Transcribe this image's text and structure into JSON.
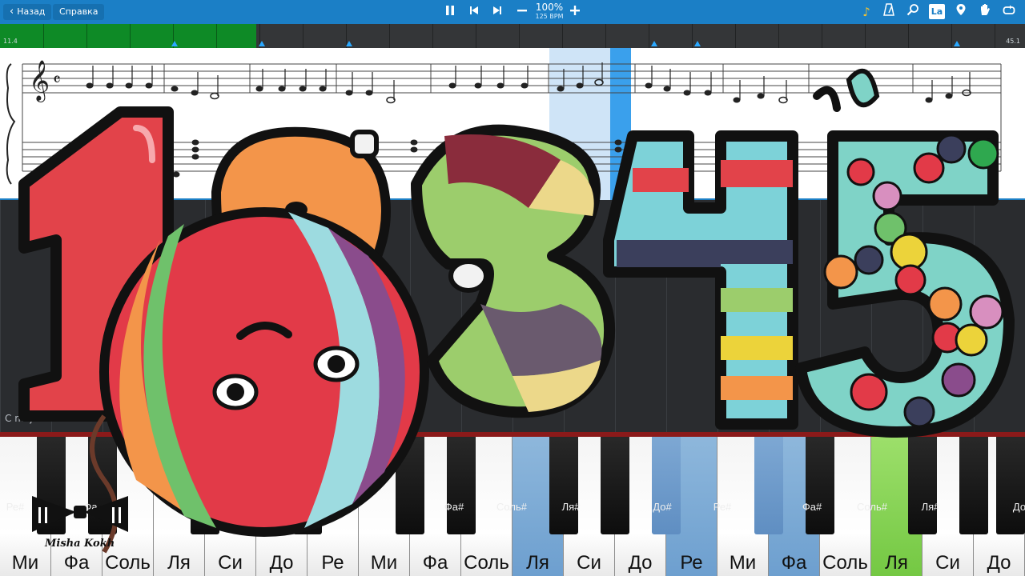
{
  "toolbar": {
    "back_label": "Назад",
    "help_label": "Справка",
    "zoom": "100%",
    "bpm": "125 BPM",
    "note_names_badge": "La",
    "icons": [
      "pause-icon",
      "skip-back-icon",
      "skip-forward-icon",
      "minus-icon",
      "plus-icon",
      "music-note-icon",
      "metronome-icon",
      "magnifier-icon",
      "note-names-icon",
      "location-pin-icon",
      "hand-icon",
      "loop-icon"
    ],
    "accent": "#1b7fc6"
  },
  "timeline": {
    "start_label": "11.4",
    "end_label": "45.1",
    "progress_percent": 25,
    "fill_color": "#0e8a26"
  },
  "key_signature_label": "C major",
  "keyboard": {
    "white_keys": [
      "Ми",
      "Фа",
      "Соль",
      "Ля",
      "Си",
      "До",
      "Ре",
      "Ми",
      "Фа",
      "Соль",
      "Ля",
      "Си",
      "До",
      "Ре",
      "Ми",
      "Фа",
      "Соль",
      "Ля",
      "Си",
      "До"
    ],
    "black_keys": [
      "Ре#",
      "Фа",
      "",
      "",
      "",
      "",
      "",
      "",
      "",
      "Фа#",
      "Соль#",
      "Ля#",
      "",
      "До#",
      "Ре#",
      "",
      "Фа#",
      "Соль#",
      "Ля#",
      "До"
    ],
    "highlighted_blue": [
      "Ля",
      "Ре",
      "Фа"
    ],
    "highlighted_green": [
      "Ля"
    ]
  },
  "logo": {
    "text": "Misha Kokh"
  }
}
